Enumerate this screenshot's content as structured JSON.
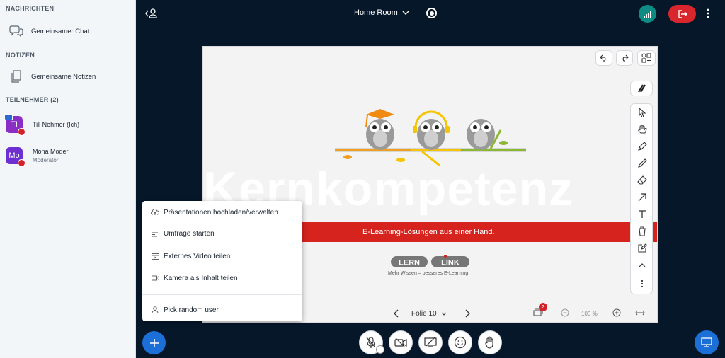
{
  "sidebar": {
    "messages_header": "NACHRICHTEN",
    "chat_label": "Gemeinsamer Chat",
    "notes_header": "NOTIZEN",
    "notes_label": "Gemeinsame Notizen",
    "participants_header": "TEILNEHMER (2)",
    "users": [
      {
        "initials": "TI",
        "name": "Till Nehmer (Ich)",
        "role": "",
        "color": "#8a2fc6"
      },
      {
        "initials": "Mo",
        "name": "Mona Moderi",
        "role": "Moderator",
        "color": "#6d2fd0"
      }
    ]
  },
  "topbar": {
    "room_title": "Home Room"
  },
  "presentation": {
    "big_text": "Kernkompetenz",
    "band_text": "E-Learning-Lösungen aus einer Hand.",
    "logo_left": "LERN",
    "logo_right": "LINK",
    "slogan": "Mehr Wissen – besseres E-Learning",
    "page_label": "Folie 10",
    "zoom": "100 %",
    "slides_badge": "2"
  },
  "actions_menu": {
    "items": [
      "Präsentationen hochladen/verwalten",
      "Umfrage starten",
      "Externes Video teilen",
      "Kamera als Inhalt teilen",
      "Pick random user"
    ]
  },
  "colors": {
    "background": "#06172a",
    "sidebar": "#f3f6f9",
    "primary": "#1b6fd6",
    "leave": "#d8262c",
    "connection": "#0e8b82",
    "band": "#d6231e"
  }
}
